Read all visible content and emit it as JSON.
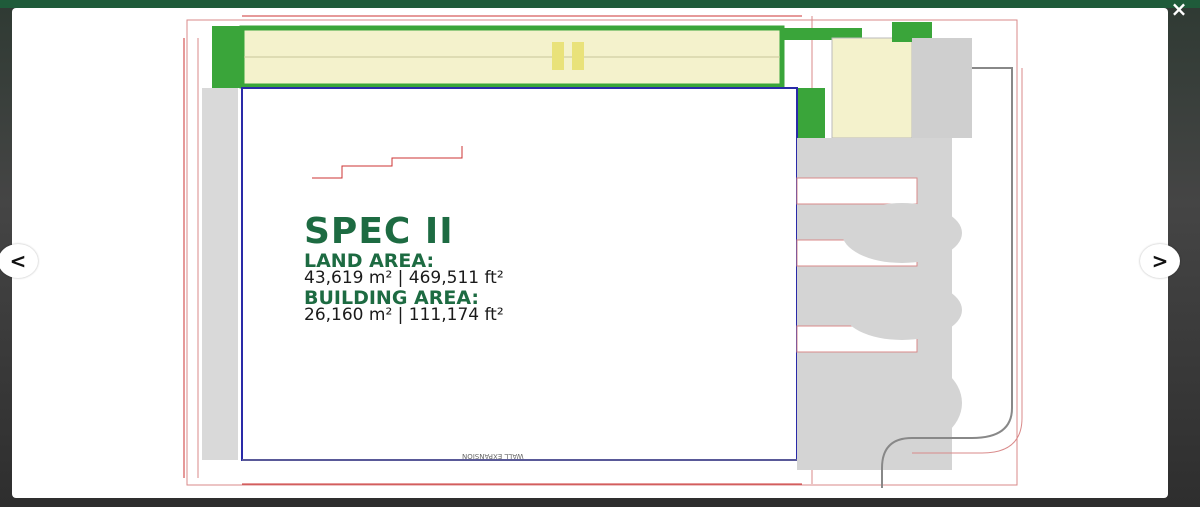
{
  "viewer": {
    "close_icon": "×",
    "prev_icon": "<",
    "next_icon": ">"
  },
  "plan": {
    "title": "SPEC II",
    "land_area_label": "LAND AREA:",
    "land_area_value": "43,619 m² | 469,511 ft²",
    "building_area_label": "BUILDING AREA:",
    "building_area_value": "26,160 m² | 111,174 ft²",
    "wall_note": "WALL EXPANSION",
    "colors": {
      "accent": "#1d6b42",
      "landscape": "#3aa53a",
      "parking": "#f4f2cc",
      "pavement": "#cfcfcf",
      "dimension": "#cc3333",
      "building_edge": "#2a2aa8"
    }
  }
}
